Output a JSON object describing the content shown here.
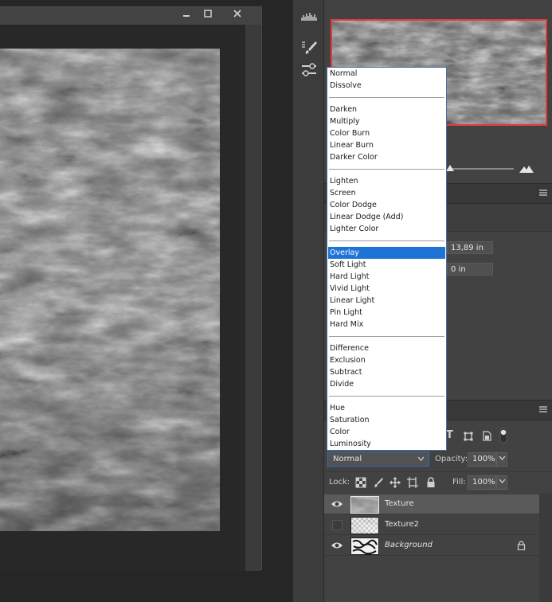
{
  "properties": {
    "width_value": "13,89 in",
    "y_value": "0 in"
  },
  "layers_panel": {
    "blend_mode_selected": "Normal",
    "opacity_label": "Opacity:",
    "opacity_value": "100%",
    "lock_label": "Lock:",
    "fill_label": "Fill:",
    "fill_value": "100%",
    "filter_type_glyph": "T",
    "layers": [
      {
        "name": "Texture",
        "visible": true,
        "selected": true,
        "italic": false,
        "locked": false
      },
      {
        "name": "Texture2",
        "visible": false,
        "selected": false,
        "italic": false,
        "locked": false
      },
      {
        "name": "Background",
        "visible": true,
        "selected": false,
        "italic": true,
        "locked": true
      }
    ]
  },
  "blend_dropdown": {
    "groups": [
      [
        "Normal",
        "Dissolve"
      ],
      [
        "Darken",
        "Multiply",
        "Color Burn",
        "Linear Burn",
        "Darker Color"
      ],
      [
        "Lighten",
        "Screen",
        "Color Dodge",
        "Linear Dodge (Add)",
        "Lighter Color"
      ],
      [
        "Overlay",
        "Soft Light",
        "Hard Light",
        "Vivid Light",
        "Linear Light",
        "Pin Light",
        "Hard Mix"
      ],
      [
        "Difference",
        "Exclusion",
        "Subtract",
        "Divide"
      ],
      [
        "Hue",
        "Saturation",
        "Color",
        "Luminosity"
      ]
    ],
    "highlighted": "Overlay"
  },
  "colors": {
    "dropdown_highlight": "#1e73d6",
    "navigator_frame": "#e23b3b",
    "panel_bg": "#424242"
  },
  "icons": {
    "window_minimize": "minimize-icon",
    "window_maximize": "maximize-icon",
    "window_close": "close-icon",
    "histogram": "histogram-icon",
    "brush_settings": "brush-settings-icon",
    "clone_source": "clone-source-icon"
  }
}
